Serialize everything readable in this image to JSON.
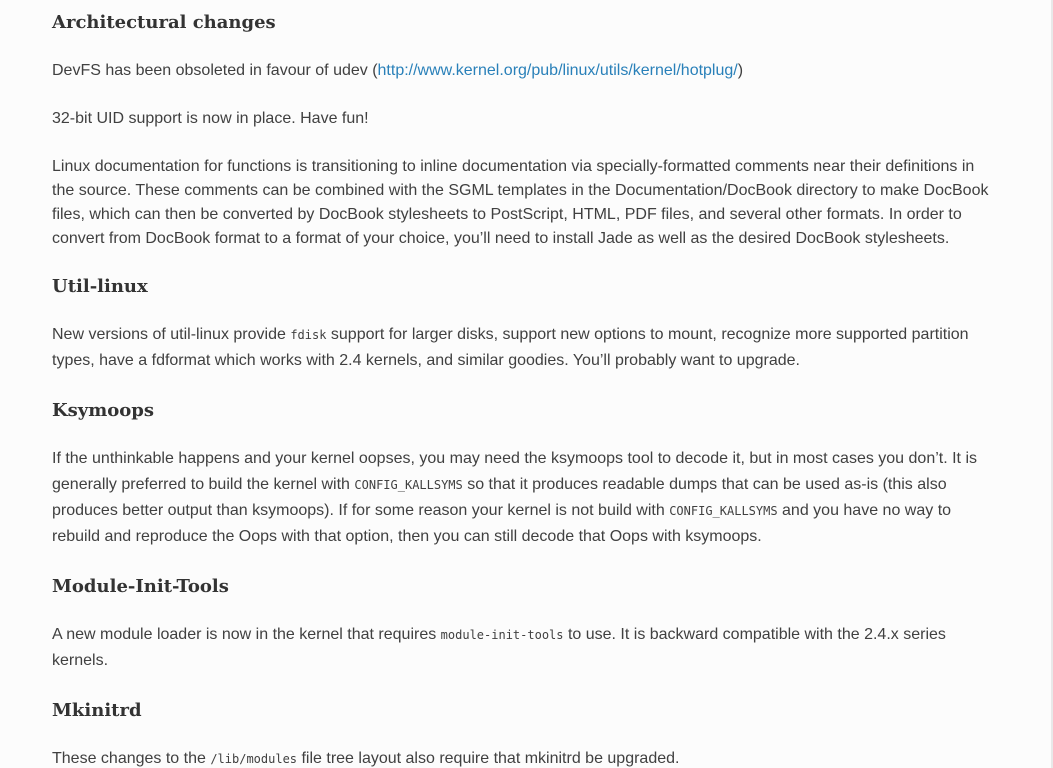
{
  "sections": {
    "architectural": {
      "heading": "Architectural changes",
      "devfs_prefix": "DevFS has been obsoleted in favour of udev (",
      "devfs_link": "http://www.kernel.org/pub/linux/utils/kernel/hotplug/",
      "devfs_suffix": ")",
      "uid_text": "32-bit UID support is now in place. Have fun!",
      "docs_text": "Linux documentation for functions is transitioning to inline documentation via specially-formatted comments near their definitions in the source. These comments can be combined with the SGML templates in the Documentation/DocBook directory to make DocBook files, which can then be converted by DocBook stylesheets to PostScript, HTML, PDF files, and several other formats. In order to convert from DocBook format to a format of your choice, you’ll need to install Jade as well as the desired DocBook stylesheets."
    },
    "util_linux": {
      "heading": "Util-linux",
      "text_before": "New versions of util-linux provide ",
      "code": "fdisk",
      "text_after": " support for larger disks, support new options to mount, recognize more supported partition types, have a fdformat which works with 2.4 kernels, and similar goodies. You’ll probably want to upgrade."
    },
    "ksymoops": {
      "heading": "Ksymoops",
      "text_1": "If the unthinkable happens and your kernel oopses, you may need the ksymoops tool to decode it, but in most cases you don’t. It is generally preferred to build the kernel with ",
      "code_1": "CONFIG_KALLSYMS",
      "text_2": " so that it produces readable dumps that can be used as-is (this also produces better output than ksymoops). If for some reason your kernel is not build with ",
      "code_2": "CONFIG_KALLSYMS",
      "text_3": " and you have no way to rebuild and reproduce the Oops with that option, then you can still decode that Oops with ksymoops."
    },
    "module_init_tools": {
      "heading": "Module-Init-Tools",
      "text_before": "A new module loader is now in the kernel that requires ",
      "code": "module-init-tools",
      "text_after": " to use. It is backward compatible with the 2.4.x series kernels."
    },
    "mkinitrd": {
      "heading": "Mkinitrd",
      "text_before": "These changes to the ",
      "code": "/lib/modules",
      "text_after": " file tree layout also require that mkinitrd be upgraded."
    }
  }
}
